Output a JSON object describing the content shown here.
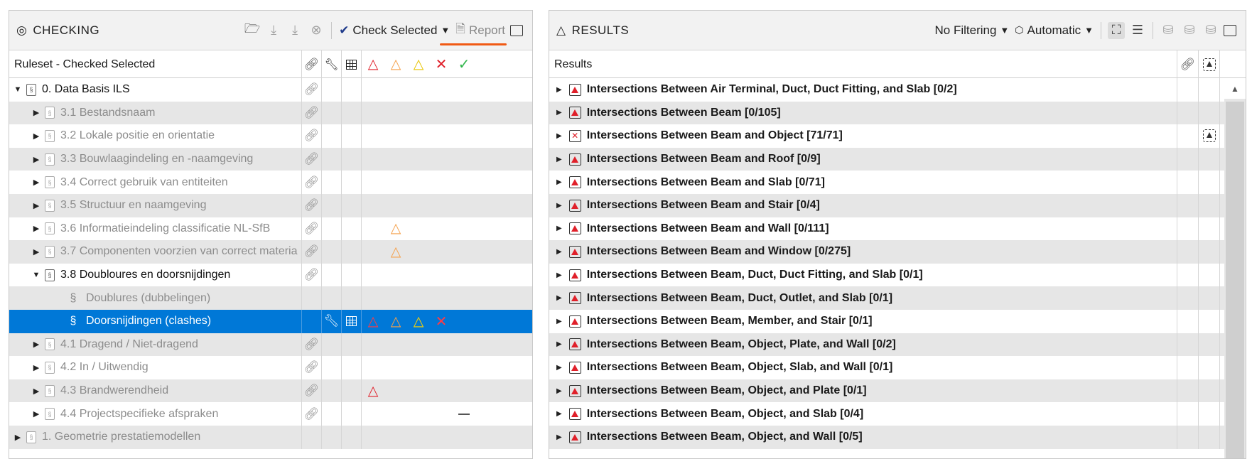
{
  "checking": {
    "title": "CHECKING",
    "check_selected_label": "Check Selected",
    "report_label": "Report",
    "header": {
      "ruleset_label": "Ruleset - Checked Selected"
    },
    "rows": [
      {
        "label": "0. Data Basis ILS",
        "level": 0,
        "expanded": true,
        "muted": false,
        "icon": "book",
        "clip": true
      },
      {
        "label": "3.1 Bestandsnaam",
        "level": 1,
        "expanded": false,
        "muted": true,
        "icon": "book",
        "clip": true
      },
      {
        "label": "3.2 Lokale positie en orientatie",
        "level": 1,
        "expanded": false,
        "muted": true,
        "icon": "book",
        "clip": true
      },
      {
        "label": "3.3 Bouwlaagindeling en -naamgeving",
        "level": 1,
        "expanded": false,
        "muted": true,
        "icon": "book",
        "clip": true
      },
      {
        "label": "3.4 Correct gebruik van entiteiten",
        "level": 1,
        "expanded": false,
        "muted": true,
        "icon": "book",
        "clip": true
      },
      {
        "label": "3.5 Structuur en naamgeving",
        "level": 1,
        "expanded": false,
        "muted": true,
        "icon": "book",
        "clip": true
      },
      {
        "label": "3.6 Informatieindeling classificatie NL-SfB",
        "level": 1,
        "expanded": false,
        "muted": true,
        "icon": "book",
        "clip": true,
        "orange": true
      },
      {
        "label": "3.7 Componenten voorzien van correct materia",
        "level": 1,
        "expanded": false,
        "muted": true,
        "icon": "book",
        "clip": true,
        "orange": true
      },
      {
        "label": "3.8 Doubloures en doorsnijdingen",
        "level": 1,
        "expanded": true,
        "muted": false,
        "icon": "book",
        "clip": true
      },
      {
        "label": "Doublures (dubbelingen)",
        "level": 2,
        "muted": true,
        "icon": "para"
      },
      {
        "label": "Doorsnijdingen (clashes)",
        "level": 2,
        "muted": false,
        "icon": "para",
        "selected": true
      },
      {
        "label": "4.1 Dragend / Niet-dragend",
        "level": 1,
        "expanded": false,
        "muted": true,
        "icon": "book",
        "clip": true
      },
      {
        "label": "4.2 In / Uitwendig",
        "level": 1,
        "expanded": false,
        "muted": true,
        "icon": "book",
        "clip": true
      },
      {
        "label": "4.3 Brandwerendheid",
        "level": 1,
        "expanded": false,
        "muted": true,
        "icon": "book",
        "clip": true,
        "red": true
      },
      {
        "label": "4.4 Projectspecifieke afspraken",
        "level": 1,
        "expanded": false,
        "muted": true,
        "icon": "book",
        "clip": true,
        "dash": true
      },
      {
        "label": "1. Geometrie prestatiemodellen",
        "level": 0,
        "expanded": false,
        "muted": true,
        "icon": "book"
      }
    ]
  },
  "results": {
    "title": "RESULTS",
    "filter_label": "No Filtering",
    "mode_label": "Automatic",
    "header": {
      "results_label": "Results"
    },
    "rows": [
      {
        "label": "Intersections Between Air Terminal, Duct, Duct Fitting, and Slab [0/2]",
        "icon": "warn"
      },
      {
        "label": "Intersections Between Beam [0/105]",
        "icon": "warn"
      },
      {
        "label": "Intersections Between Beam and Object [71/71]",
        "icon": "x",
        "scan": true
      },
      {
        "label": "Intersections Between Beam and Roof [0/9]",
        "icon": "warn"
      },
      {
        "label": "Intersections Between Beam and Slab [0/71]",
        "icon": "warn"
      },
      {
        "label": "Intersections Between Beam and Stair [0/4]",
        "icon": "warn"
      },
      {
        "label": "Intersections Between Beam and Wall [0/111]",
        "icon": "warn"
      },
      {
        "label": "Intersections Between Beam and Window [0/275]",
        "icon": "warn"
      },
      {
        "label": "Intersections Between Beam, Duct, Duct Fitting, and Slab [0/1]",
        "icon": "warn"
      },
      {
        "label": "Intersections Between Beam, Duct, Outlet, and Slab [0/1]",
        "icon": "warn"
      },
      {
        "label": "Intersections Between Beam, Member, and Stair [0/1]",
        "icon": "warn"
      },
      {
        "label": "Intersections Between Beam, Object, Plate, and Wall [0/2]",
        "icon": "warn"
      },
      {
        "label": "Intersections Between Beam, Object, Slab, and Wall [0/1]",
        "icon": "warn"
      },
      {
        "label": "Intersections Between Beam, Object, and Plate [0/1]",
        "icon": "warn"
      },
      {
        "label": "Intersections Between Beam, Object, and Slab [0/4]",
        "icon": "warn"
      },
      {
        "label": "Intersections Between Beam, Object, and Wall [0/5]",
        "icon": "warn"
      }
    ]
  },
  "colors": {
    "selection": "#0078d7",
    "error_red": "#e0202a",
    "warning_orange": "#f5a04a",
    "warning_yellow": "#e8c400",
    "ok_green": "#2fb54a",
    "report_underline": "#f05a14"
  }
}
